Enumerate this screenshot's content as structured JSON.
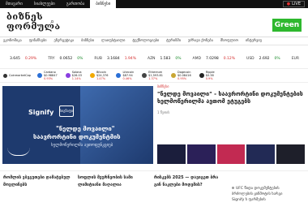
{
  "topbar": {
    "tabs": [
      "მთავარი",
      "სიახლეები",
      "გართობა",
      "ბიზნესი"
    ],
    "active_index": 3,
    "live_label": "LIVE"
  },
  "header": {
    "logo_line1": "ბიზნეს",
    "logo_line2": "ფორმულა",
    "search_icon": "search-icon",
    "ad_label": "Green"
  },
  "nav": {
    "items": [
      "ეკონომიკა",
      "ფინანსები",
      "ენერგეტიკა",
      "ბიზნესი",
      "ლაიფსტაილი",
      "ტექნოლოგიები",
      "ტურიზმი",
      "უძრავი ქონება",
      "მსოფლიო",
      "ინტერვიუ"
    ]
  },
  "ticker": [
    {
      "name": "",
      "value": "3.645",
      "change": "0.29%",
      "dir": "neg"
    },
    {
      "name": "TRY",
      "value": "0.0652",
      "change": "0%",
      "dir": "pos"
    },
    {
      "name": "RUB",
      "value": "3.1684",
      "change": "1.94%",
      "dir": "neg"
    },
    {
      "name": "AZN",
      "value": "1.583",
      "change": "0%",
      "dir": "pos"
    },
    {
      "name": "AMD",
      "value": "7.0298",
      "change": "0.12%",
      "dir": "neg"
    },
    {
      "name": "USD",
      "value": "2.692",
      "change": "0%",
      "dir": "pos"
    },
    {
      "name": "EUR",
      "value": "",
      "change": "",
      "dir": "neg"
    }
  ],
  "crypto": {
    "brand": "CoinmarketCap",
    "coins": [
      {
        "name": "Cardano",
        "price": "$0.98847",
        "change": "0.93%",
        "color": "#2a6fd6"
      },
      {
        "name": "Solana",
        "price": "$26.03",
        "change": "1.14%",
        "color": "#8a3ee0"
      },
      {
        "name": "Bitcoin",
        "price": "$24,376",
        "change": "1.47%",
        "color": "#f2a900"
      },
      {
        "name": "Litecoin",
        "price": "$87.94",
        "change": "0.46%",
        "color": "#2a6fd6"
      },
      {
        "name": "Ethereum",
        "price": "$1,593.81",
        "change": "1.37%",
        "color": "#444"
      },
      {
        "name": "Dogecoin",
        "price": "$0.08416",
        "change": "0.95%",
        "color": "#c9a634"
      },
      {
        "name": "Ripple",
        "price": "$0.38",
        "change": "0.9%",
        "color": "#222"
      }
    ]
  },
  "hero": {
    "brand": "Signify",
    "tv_label": "სიგნაფი",
    "headline1": "\"ნელდე მოვაილი\"",
    "headline2": "საავრორტინი დოკუმენტმის",
    "headline3": "ხელმოწერილმა ავთოფუნკციებ"
  },
  "article": {
    "category": "ბიზნესი",
    "title": "\"ნელდე მოვაილი\" - საავრორტინი დოკუმენტების ხელმოწერილმა ავთომ ეტუგებს",
    "time": "1 წუთის"
  },
  "thumbs": [
    "#1b1e3c",
    "#2b2058",
    "#c22a52",
    "#222a55",
    "#1e1f2a"
  ],
  "bottom": {
    "col1": [
      "რომლის ვბეგუთები დამატებულ",
      "მოვლინებს"
    ],
    "col2": [
      "სოფლის მეურნეობის სამი",
      "ლიმიტიანი მაღალია"
    ],
    "col3": [
      "რისკებს 2025 — დავიგეთ ბრა",
      "გინ ნაკლები მოდემის?"
    ],
    "side": [
      "UFC წიდა დოკუმენტების",
      "ბრძოლების ყინმოტის ხარგი",
      "Signify ხ ფარმების"
    ]
  }
}
